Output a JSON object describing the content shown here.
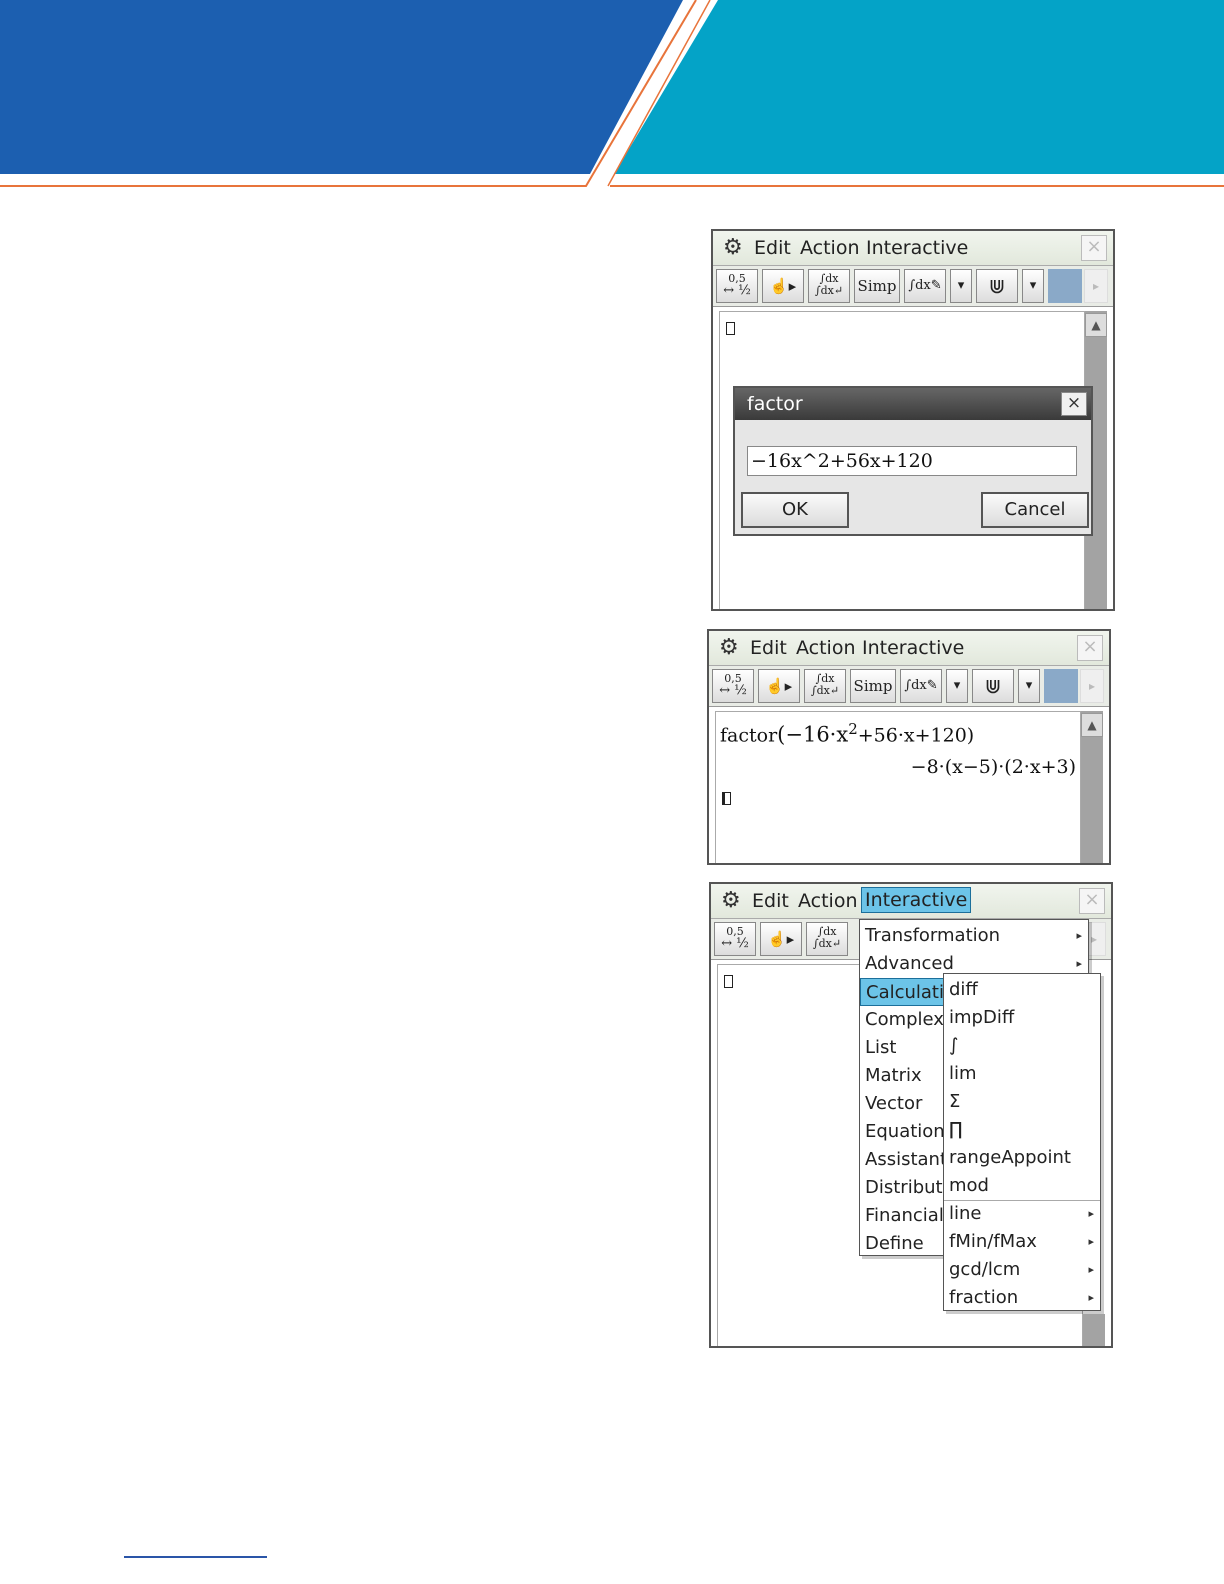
{
  "colors": {
    "banner_left": "#1c5fb0",
    "banner_right": "#04a3c7",
    "accent_line": "#e8743b",
    "menu_highlight": "#6cc4e8"
  },
  "menubar": {
    "gear": "⚙",
    "edit": "Edit",
    "action": "Action",
    "interactive": "Interactive",
    "close": "×"
  },
  "toolbar": {
    "decimal_top": "0,5",
    "decimal_bottom": "↔ ½",
    "hand": "☝▸",
    "integral_top": "∫dx",
    "integral_bottom": "∫dx↵",
    "simp": "Simp",
    "integral_pen": "∫dx✎",
    "dropdown": "▾",
    "graph": "⋓",
    "scroll_right": "▸"
  },
  "scroll_up": "▲",
  "screen1": {
    "dialog": {
      "title": "factor",
      "close": "×",
      "input_value": "−16x^2+56x+120",
      "ok": "OK",
      "cancel": "Cancel"
    }
  },
  "screen2": {
    "input_func": "factor",
    "input_args": "(−16·x",
    "input_exp": "2",
    "input_rest": "+56·x+120)",
    "result": "−8·(x−5)·(2·x+3)"
  },
  "screen3": {
    "interactive_menu": [
      "Transformation",
      "Advanced",
      "Calculation",
      "Complex",
      "List",
      "Matrix",
      "Vector",
      "Equation/",
      "Assistant",
      "Distributi",
      "Financial",
      "Define"
    ],
    "interactive_submenu_flags": [
      true,
      true,
      false,
      false,
      false,
      false,
      false,
      false,
      false,
      false,
      false,
      false
    ],
    "selected_item": "Calculation",
    "calculation_submenu": [
      "diff",
      "impDiff",
      "∫",
      "lim",
      "Σ",
      "∏",
      "rangeAppoint",
      "mod",
      "line",
      "fMin/fMax",
      "gcd/lcm",
      "fraction"
    ],
    "calculation_submenu_flags": [
      false,
      false,
      false,
      false,
      false,
      false,
      false,
      false,
      true,
      true,
      true,
      true
    ],
    "submenu_arrow": "▸"
  }
}
